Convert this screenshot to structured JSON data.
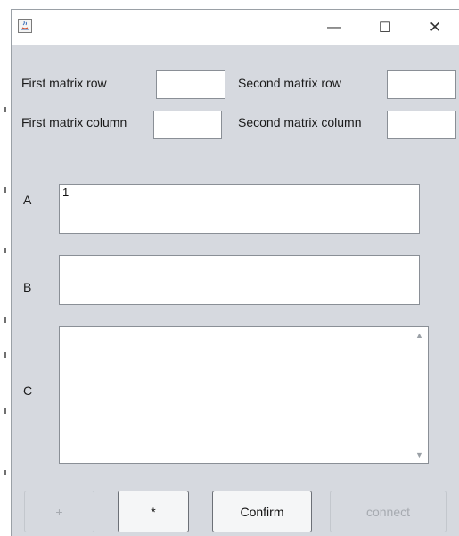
{
  "titlebar": {
    "minimize": "—",
    "maximize": "☐",
    "close": "✕"
  },
  "labels": {
    "first_row": "First matrix row",
    "first_col": "First matrix column",
    "second_row": "Second matrix row",
    "second_col": "Second matrix column",
    "a": "A",
    "b": "B",
    "c": "C"
  },
  "inputs": {
    "first_row": "",
    "first_col": "",
    "second_row": "",
    "second_col": ""
  },
  "areas": {
    "a": "1",
    "b": "",
    "c": ""
  },
  "scroll": {
    "up": "▲",
    "down": "▼"
  },
  "buttons": {
    "plus": "+",
    "multiply": "*",
    "confirm": "Confirm",
    "connect": "connect"
  },
  "colors": {
    "window_bg": "#d6d9df",
    "disabled_text": "#a6aab0"
  }
}
